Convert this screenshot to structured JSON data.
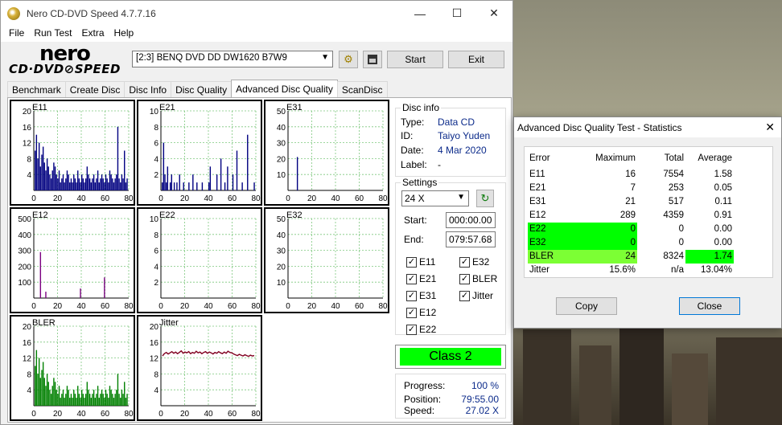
{
  "window": {
    "title": "Nero CD-DVD Speed 4.7.7.16",
    "min": "—",
    "max": "☐",
    "close": "✕"
  },
  "menu": [
    "File",
    "Run Test",
    "Extra",
    "Help"
  ],
  "logo": {
    "line1": "nero",
    "line2": "CD·DVD⊘SPEED"
  },
  "toolbar": {
    "drive": "[2:3]   BENQ DVD DD DW1620 B7W9",
    "start": "Start",
    "exit": "Exit"
  },
  "tabs": [
    "Benchmark",
    "Create Disc",
    "Disc Info",
    "Disc Quality",
    "Advanced Disc Quality",
    "ScanDisc"
  ],
  "disc_info": {
    "title": "Disc info",
    "type_label": "Type:",
    "type": "Data CD",
    "id_label": "ID:",
    "id": "Taiyo Yuden",
    "date_label": "Date:",
    "date": "4 Mar 2020",
    "label_label": "Label:",
    "label": "-"
  },
  "settings": {
    "title": "Settings",
    "speed": "24 X",
    "start_label": "Start:",
    "start": "000:00.00",
    "end_label": "End:",
    "end": "079:57.68",
    "checks": [
      {
        "label": "E11",
        "checked": true
      },
      {
        "label": "E32",
        "checked": true
      },
      {
        "label": "E21",
        "checked": true
      },
      {
        "label": "BLER",
        "checked": true
      },
      {
        "label": "E31",
        "checked": true
      },
      {
        "label": "Jitter",
        "checked": true
      },
      {
        "label": "E12",
        "checked": true
      },
      {
        "label": "E22",
        "checked": true
      }
    ]
  },
  "class_label": "Class 2",
  "progress": {
    "progress_label": "Progress:",
    "progress": "100 %",
    "position_label": "Position:",
    "position": "79:55.00",
    "speed_label": "Speed:",
    "speed": "27.02 X"
  },
  "chart_data": [
    {
      "type": "bar",
      "title": "E11",
      "xticks": [
        "0",
        "20",
        "40",
        "60",
        "80"
      ],
      "yticks": [
        "20",
        "16",
        "12",
        "8",
        "4"
      ],
      "ylim": [
        0,
        20
      ],
      "color": "#000080",
      "values": [
        10,
        14,
        8,
        12,
        6,
        9,
        11,
        7,
        5,
        8,
        6,
        4,
        3,
        5,
        7,
        6,
        4,
        3,
        5,
        2,
        3,
        4,
        2,
        3,
        5,
        4,
        2,
        3,
        2,
        4,
        3,
        2,
        5,
        3,
        2,
        4,
        3,
        2,
        3,
        6,
        4,
        3,
        2,
        3,
        4,
        2,
        3,
        5,
        2,
        3,
        4,
        3,
        2,
        4,
        3,
        2,
        5,
        4,
        3,
        2,
        3,
        4,
        16,
        3,
        2,
        4,
        3,
        10,
        2,
        3
      ]
    },
    {
      "type": "bar",
      "title": "E21",
      "xticks": [
        "0",
        "20",
        "40",
        "60",
        "80"
      ],
      "yticks": [
        "10",
        "8",
        "6",
        "4",
        "2"
      ],
      "ylim": [
        0,
        10
      ],
      "color": "#000080",
      "values": [
        1,
        6,
        2,
        1,
        3,
        0,
        1,
        2,
        0,
        1,
        0,
        1,
        0,
        2,
        0,
        0,
        1,
        0,
        0,
        0,
        1,
        0,
        0,
        2,
        0,
        0,
        1,
        0,
        0,
        0,
        1,
        0,
        0,
        0,
        0,
        1,
        3,
        0,
        0,
        0,
        0,
        2,
        0,
        0,
        4,
        0,
        0,
        1,
        0,
        3,
        0,
        0,
        0,
        2,
        0,
        0,
        5,
        0,
        0,
        0,
        1,
        0,
        0,
        0,
        7,
        0,
        0,
        0,
        0,
        1
      ]
    },
    {
      "type": "bar",
      "title": "E31",
      "xticks": [
        "0",
        "20",
        "40",
        "60",
        "80"
      ],
      "yticks": [
        "50",
        "40",
        "30",
        "20",
        "10"
      ],
      "ylim": [
        0,
        50
      ],
      "color": "#000080",
      "values": [
        0,
        0,
        0,
        0,
        0,
        0,
        21,
        0,
        0,
        0,
        0,
        0,
        0,
        0,
        0,
        0,
        0,
        0,
        0,
        0,
        0,
        0,
        0,
        0,
        0,
        0,
        0,
        0,
        0,
        0,
        0,
        0,
        0,
        0,
        0,
        0,
        0,
        0,
        0,
        0,
        0,
        0,
        0,
        0,
        0,
        0,
        0,
        0,
        0,
        0,
        0,
        0,
        0,
        0,
        0,
        0,
        0,
        0,
        0,
        0,
        0,
        0,
        0,
        0,
        0,
        0,
        0,
        0,
        0,
        0
      ]
    },
    {
      "type": "bar",
      "title": "E12",
      "xticks": [
        "0",
        "20",
        "40",
        "60",
        "80"
      ],
      "yticks": [
        "500",
        "400",
        "300",
        "200",
        "100"
      ],
      "ylim": [
        0,
        500
      ],
      "color": "#7a0080",
      "values": [
        0,
        0,
        0,
        0,
        289,
        0,
        0,
        0,
        40,
        0,
        0,
        0,
        0,
        0,
        0,
        0,
        0,
        0,
        0,
        0,
        0,
        0,
        0,
        0,
        0,
        0,
        0,
        0,
        0,
        0,
        0,
        0,
        0,
        0,
        60,
        0,
        0,
        0,
        0,
        0,
        0,
        0,
        0,
        0,
        0,
        0,
        0,
        0,
        0,
        0,
        0,
        0,
        130,
        0,
        0,
        0,
        0,
        0,
        0,
        0,
        0,
        0,
        0,
        0,
        0,
        0,
        0,
        0,
        0,
        0
      ]
    },
    {
      "type": "bar",
      "title": "E22",
      "xticks": [
        "0",
        "20",
        "40",
        "60",
        "80"
      ],
      "yticks": [
        "10",
        "8",
        "6",
        "4",
        "2"
      ],
      "ylim": [
        0,
        10
      ],
      "color": "#000080",
      "values": []
    },
    {
      "type": "bar",
      "title": "E32",
      "xticks": [
        "0",
        "20",
        "40",
        "60",
        "80"
      ],
      "yticks": [
        "50",
        "40",
        "30",
        "20",
        "10"
      ],
      "ylim": [
        0,
        50
      ],
      "color": "#000080",
      "values": []
    },
    {
      "type": "bar",
      "title": "BLER",
      "xticks": [
        "0",
        "20",
        "40",
        "60",
        "80"
      ],
      "yticks": [
        "20",
        "16",
        "12",
        "8",
        "4"
      ],
      "ylim": [
        0,
        20
      ],
      "color": "#008000",
      "values": [
        10,
        14,
        8,
        12,
        7,
        9,
        11,
        7,
        5,
        8,
        6,
        4,
        3,
        5,
        7,
        6,
        4,
        3,
        5,
        2,
        3,
        4,
        2,
        3,
        5,
        4,
        2,
        3,
        2,
        4,
        3,
        2,
        5,
        3,
        2,
        4,
        3,
        2,
        3,
        6,
        4,
        3,
        2,
        3,
        4,
        2,
        3,
        5,
        2,
        3,
        4,
        3,
        2,
        4,
        3,
        2,
        5,
        4,
        3,
        2,
        3,
        4,
        8,
        3,
        2,
        4,
        3,
        6,
        2,
        3
      ]
    },
    {
      "type": "line",
      "title": "Jitter",
      "xticks": [
        "0",
        "20",
        "40",
        "60",
        "80"
      ],
      "yticks": [
        "20",
        "16",
        "12",
        "8",
        "4"
      ],
      "ylim": [
        0,
        20
      ],
      "color": "#800020",
      "values": [
        12.5,
        13.1,
        13.4,
        13.0,
        13.3,
        13.6,
        13.2,
        13.5,
        13.1,
        13.4,
        13.8,
        13.2,
        13.5,
        13.3,
        13.6,
        13.1,
        13.4,
        13.2,
        13.7,
        13.3,
        13.5,
        13.1,
        13.4,
        13.6,
        13.2,
        13.5,
        13.3,
        13.0,
        13.4,
        13.2,
        13.6,
        13.3,
        13.1,
        13.5,
        13.2,
        13.7,
        13.4,
        13.3,
        13.0,
        12.8,
        12.6,
        12.9,
        12.7,
        12.5,
        12.8,
        12.6,
        12.4,
        12.7,
        12.5,
        12.6
      ]
    }
  ],
  "stats": {
    "title": "Advanced Disc Quality Test - Statistics",
    "close": "✕",
    "headers": [
      "Error",
      "Maximum",
      "Total",
      "Average"
    ],
    "rows": [
      [
        "E11",
        "16",
        "7554",
        "1.58"
      ],
      [
        "E21",
        "7",
        "253",
        "0.05"
      ],
      [
        "E31",
        "21",
        "517",
        "0.11"
      ],
      [
        "E12",
        "289",
        "4359",
        "0.91"
      ],
      [
        "E22",
        "0",
        "0",
        "0.00"
      ],
      [
        "E32",
        "0",
        "0",
        "0.00"
      ],
      [
        "BLER",
        "24",
        "8324",
        "1.74"
      ],
      [
        "Jitter",
        "15.6%",
        "n/a",
        "13.04%"
      ]
    ],
    "copy": "Copy",
    "close_btn": "Close",
    "colors": {
      "green": "#00ff00",
      "lime": "#7cff34"
    }
  }
}
